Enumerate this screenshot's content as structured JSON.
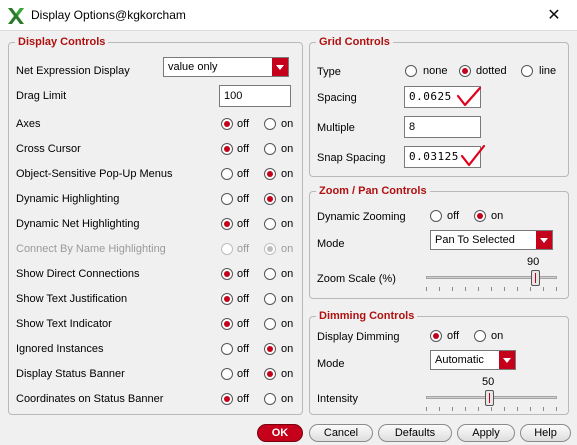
{
  "window": {
    "title": "Display Options@kgkorcham"
  },
  "display_controls": {
    "title": "Display Controls",
    "net_expression": {
      "label": "Net Expression Display",
      "value": "value only"
    },
    "drag_limit": {
      "label": "Drag Limit",
      "value": "100"
    },
    "toggles": [
      {
        "label": "Axes",
        "selected": "off",
        "disabled": false
      },
      {
        "label": "Cross Cursor",
        "selected": "off",
        "disabled": false
      },
      {
        "label": "Object-Sensitive Pop-Up Menus",
        "selected": "on",
        "disabled": false
      },
      {
        "label": "Dynamic Highlighting",
        "selected": "on",
        "disabled": false
      },
      {
        "label": "Dynamic Net Highlighting",
        "selected": "off",
        "disabled": false
      },
      {
        "label": "Connect By Name Highlighting",
        "selected": "on",
        "disabled": true
      },
      {
        "label": "Show Direct Connections",
        "selected": "off",
        "disabled": false
      },
      {
        "label": "Show Text Justification",
        "selected": "off",
        "disabled": false
      },
      {
        "label": "Show Text Indicator",
        "selected": "off",
        "disabled": false
      },
      {
        "label": "Ignored Instances",
        "selected": "on",
        "disabled": false
      },
      {
        "label": "Display Status Banner",
        "selected": "on",
        "disabled": false
      },
      {
        "label": "Coordinates on Status Banner",
        "selected": "off",
        "disabled": false
      }
    ],
    "off_label": "off",
    "on_label": "on"
  },
  "grid_controls": {
    "title": "Grid Controls",
    "type": {
      "label": "Type",
      "options": [
        "none",
        "dotted",
        "line"
      ],
      "selected": "dotted"
    },
    "spacing": {
      "label": "Spacing",
      "value": "0.0625"
    },
    "multiple": {
      "label": "Multiple",
      "value": "8"
    },
    "snap_spacing": {
      "label": "Snap Spacing",
      "value": "0.03125"
    }
  },
  "zoom_pan": {
    "title": "Zoom / Pan Controls",
    "dynamic_zooming": {
      "label": "Dynamic Zooming",
      "selected": "on"
    },
    "mode": {
      "label": "Mode",
      "value": "Pan To Selected"
    },
    "zoom_scale": {
      "label": "Zoom Scale (%)",
      "value": "90",
      "fraction": 0.9
    }
  },
  "dimming": {
    "title": "Dimming Controls",
    "display_dimming": {
      "label": "Display Dimming",
      "selected": "off"
    },
    "mode": {
      "label": "Mode",
      "value": "Automatic"
    },
    "intensity": {
      "label": "Intensity",
      "value": "50",
      "fraction": 0.5
    }
  },
  "buttons": {
    "ok": "OK",
    "cancel": "Cancel",
    "defaults": "Defaults",
    "apply": "Apply",
    "help": "Help"
  },
  "colors": {
    "accent": "#c4001a",
    "annotation": "#e0001b"
  }
}
